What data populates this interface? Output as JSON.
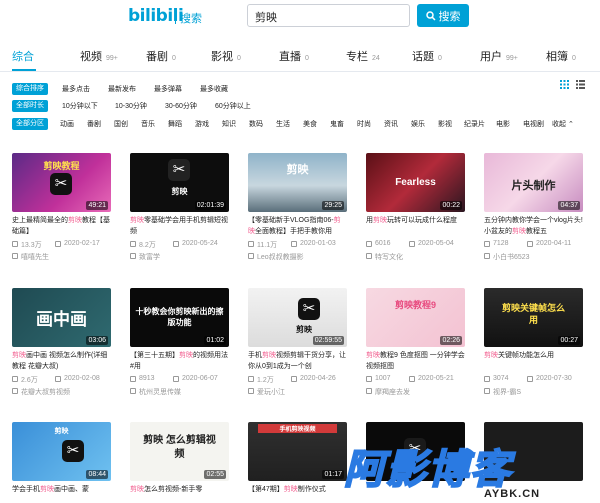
{
  "header": {
    "logo": "bilibili",
    "logo_sub": "搜索",
    "search_value": "剪映",
    "search_button": "搜索"
  },
  "tabs": [
    {
      "label": "综合",
      "count": "",
      "active": true
    },
    {
      "label": "视频",
      "count": "99+"
    },
    {
      "label": "番剧",
      "count": "0"
    },
    {
      "label": "影视",
      "count": "0"
    },
    {
      "label": "直播",
      "count": "0"
    },
    {
      "label": "专栏",
      "count": "24"
    },
    {
      "label": "话题",
      "count": "0"
    },
    {
      "label": "用户",
      "count": "99+"
    },
    {
      "label": "相簿",
      "count": "0"
    }
  ],
  "filters": {
    "order": {
      "chip": "综合排序",
      "options": [
        "最多点击",
        "最新发布",
        "最多弹幕",
        "最多收藏"
      ]
    },
    "duration": {
      "chip": "全部时长",
      "options": [
        "10分钟以下",
        "10-30分钟",
        "30-60分钟",
        "60分钟以上"
      ]
    },
    "zone": {
      "chip": "全部分区",
      "options": [
        "动画",
        "番剧",
        "国创",
        "音乐",
        "舞蹈",
        "游戏",
        "知识",
        "数码",
        "生活",
        "美食",
        "鬼畜",
        "时尚",
        "资讯",
        "娱乐",
        "影视",
        "纪录片",
        "电影",
        "电视剧"
      ],
      "collapse": "收起"
    }
  },
  "videos": [
    {
      "title_pre": "史上最精简最全的",
      "hl": "剪映",
      "title_post": "教程【基础篇】",
      "views": "13.3万",
      "date": "2020-02-17",
      "uploader": "嘻嘻先生",
      "duration": "49:21",
      "thumb_text": "剪映教程"
    },
    {
      "title_pre": "",
      "hl": "剪映",
      "title_post": "零基础学会用手机剪辑短视频",
      "views": "8.2万",
      "date": "2020-05-24",
      "uploader": "致富学",
      "duration": "02:01:39",
      "thumb_text": "剪映"
    },
    {
      "title_pre": "【零基础新手VLOG指南06-",
      "hl": "剪映",
      "title_post": "全面教程】手把手教你用",
      "views": "11.1万",
      "date": "2020-01-03",
      "uploader": "Leo叔叔教摄影",
      "duration": "29:25",
      "thumb_text": "剪映"
    },
    {
      "title_pre": "用",
      "hl": "剪映",
      "title_post": "玩转可以玩成什么程度",
      "views": "6016",
      "date": "2020-05-04",
      "uploader": "特写文化",
      "duration": "00:22",
      "thumb_text": "Fearless"
    },
    {
      "title_pre": "五分钟内教你学会一个vlog片头!小盆友的",
      "hl": "剪映",
      "title_post": "教程五",
      "views": "7128",
      "date": "2020-04-11",
      "uploader": "小白书6523",
      "duration": "04:37",
      "thumb_text": "片头制作"
    },
    {
      "title_pre": "",
      "hl": "剪映",
      "title_post": "画中画 视频怎么制作(详细教程 花瓣大叔)",
      "views": "2.6万",
      "date": "2020-02-08",
      "uploader": "花瓣大叔剪视频",
      "duration": "03:06",
      "thumb_text": "画中画"
    },
    {
      "title_pre": "【第三十五期】",
      "hl": "剪映",
      "title_post": "的视频用法#用",
      "views": "8913",
      "date": "2020-06-07",
      "uploader": "杭州灵思传媒",
      "duration": "01:02",
      "thumb_text": "十秒教会你剪映新出的擦版功能"
    },
    {
      "title_pre": "手机",
      "hl": "剪映",
      "title_post": "视频剪辑干货分享，让你从0到1成为一个创",
      "views": "1.2万",
      "date": "2020-04-26",
      "uploader": "爱玩小江",
      "duration": "02:59:55",
      "thumb_text": "剪映"
    },
    {
      "title_pre": "",
      "hl": "剪映",
      "title_post": "教程9 色度抠图 一分钟学会视频抠图",
      "views": "1007",
      "date": "2020-05-21",
      "uploader": "摩羯座去发",
      "duration": "02:26",
      "thumb_text": "剪映教程9"
    },
    {
      "title_pre": "",
      "hl": "剪映",
      "title_post": "关键帧功能怎么用",
      "views": "3074",
      "date": "2020-07-30",
      "uploader": "视界-霸S",
      "duration": "00:27",
      "thumb_text": "剪映关键帧怎么用"
    },
    {
      "title_pre": "学会手机",
      "hl": "剪映",
      "title_post": "画中画、蒙",
      "views": "",
      "date": "",
      "uploader": "",
      "duration": "08:44",
      "thumb_text": "剪映"
    },
    {
      "title_pre": "",
      "hl": "剪映",
      "title_post": "怎么剪视频-新手零",
      "views": "",
      "date": "",
      "uploader": "",
      "duration": "02:55",
      "thumb_text": "剪映 怎么剪辑视频"
    },
    {
      "title_pre": "【第47期】",
      "hl": "剪映",
      "title_post": "制作仪式",
      "views": "",
      "date": "",
      "uploader": "",
      "duration": "01:17",
      "thumb_text": "手机剪映视频"
    },
    {
      "title_pre": "",
      "hl": "",
      "title_post": "",
      "views": "",
      "date": "",
      "uploader": "",
      "duration": "",
      "thumb_text": ""
    },
    {
      "title_pre": "",
      "hl": "",
      "title_post": "",
      "views": "",
      "date": "",
      "uploader": "",
      "duration": "",
      "thumb_text": ""
    }
  ],
  "watermark": {
    "text": "阿影博客",
    "sub": "AYBK.CN"
  }
}
